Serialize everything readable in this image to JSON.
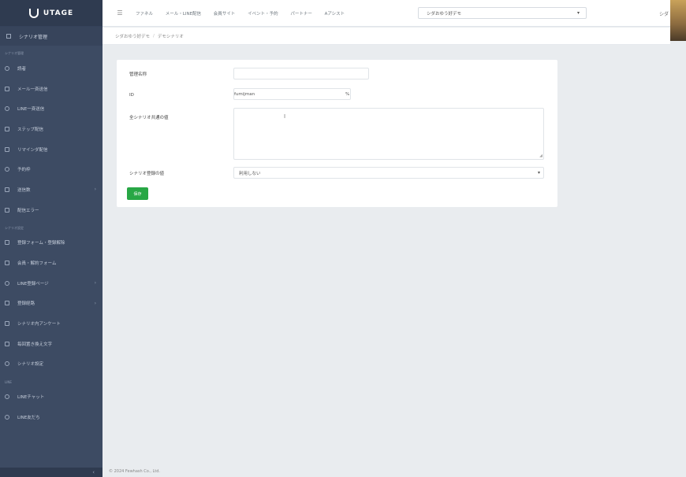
{
  "sidebar": {
    "brand": "UTAGE",
    "top_item": "シナリオ管理",
    "section1": "シナリオ管理",
    "items1": [
      "読者",
      "メール一斉送信",
      "LINE一斉送信",
      "ステップ配信",
      "リマインダ配信",
      "予約枠",
      "送信数",
      "配信エラー"
    ],
    "section2": "シナリオ設定",
    "items2": [
      "登録フォーム・登録解除",
      "会員・解約フォーム",
      "LINE登録ページ",
      "登録経路",
      "シナリオ内アンケート",
      "毎回置き換え文字",
      "シナリオ設定"
    ],
    "section3": "LINE",
    "items3": [
      "LINEチャット",
      "LINE友だち"
    ],
    "collapse": "‹"
  },
  "topbar": {
    "menu_icon": "☰",
    "nav": [
      "ファネル",
      "メール・LINE配信",
      "会員サイト",
      "イベント・予約",
      "パートナー",
      "Aアシスト"
    ],
    "account": "シダおゆう好デモ",
    "user": "シダ"
  },
  "breadcrumb": {
    "parent": "シダおゆう好デモ",
    "current": "デモシナリオ"
  },
  "form": {
    "name_label": "管理名称",
    "name_value": "",
    "id_label": "ID",
    "id_value": "fumijman",
    "id_suffix": "%",
    "desc_label": "全シナリオ共通の値",
    "cursor": "I",
    "select_label": "シナリオ登録の値",
    "select_value": "利用しない",
    "save_button": "保存"
  },
  "footer": "© 2024 Fewhash Co., Ltd."
}
